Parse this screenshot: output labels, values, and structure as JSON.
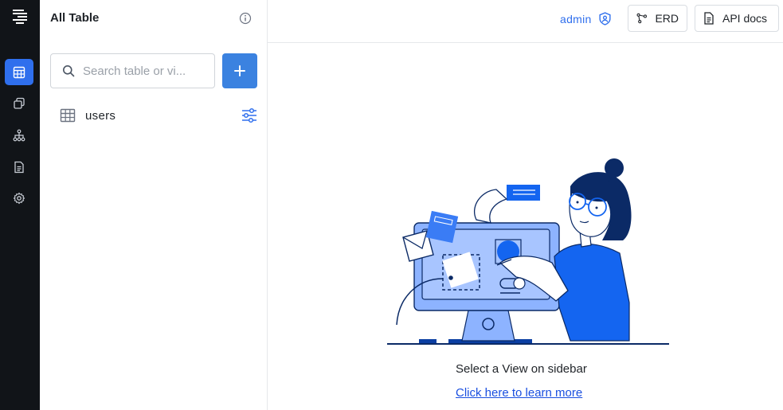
{
  "rail": {
    "items": [
      "tables",
      "views",
      "schema",
      "docs",
      "settings"
    ],
    "active": "tables"
  },
  "sidebar": {
    "title": "All Table",
    "search_placeholder": "Search table or vi...",
    "tables": [
      {
        "label": "users"
      }
    ]
  },
  "header": {
    "user_label": "admin",
    "erd_label": "ERD",
    "api_docs_label": "API docs"
  },
  "empty_state": {
    "message": "Select a View on sidebar",
    "link_text": "Click here to learn more"
  },
  "colors": {
    "accent": "#2f6fed",
    "rail_bg": "#111418",
    "add_button": "#3b82e0"
  }
}
